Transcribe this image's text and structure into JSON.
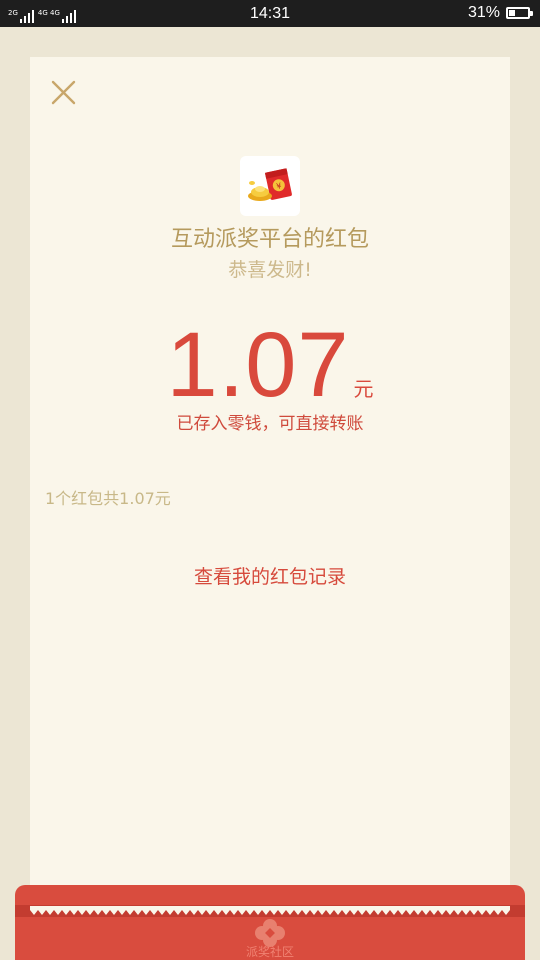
{
  "status_bar": {
    "net1_label": "2G",
    "net2_label": "4G 4G",
    "time": "14:31",
    "battery_text": "31%",
    "battery_level": 0.31
  },
  "header": {
    "close_icon": "close-icon"
  },
  "red_packet": {
    "app_icon": "red-envelope-gold-ingot-icon",
    "title": "互动派奖平台的红包",
    "blessing": "恭喜发财!",
    "amount": "1.07",
    "unit": "元",
    "stored_note": "已存入零钱，可直接转账",
    "summary": "1个红包共1.07元",
    "record_link": "查看我的红包记录"
  },
  "footer": {
    "logo_icon": "flower-logo-icon",
    "logo_text": "派奖社区"
  },
  "colors": {
    "accent_red": "#d9493c",
    "gold": "#b59a5d",
    "card_bg": "#faf6ea",
    "page_bg": "#ece6d4"
  }
}
